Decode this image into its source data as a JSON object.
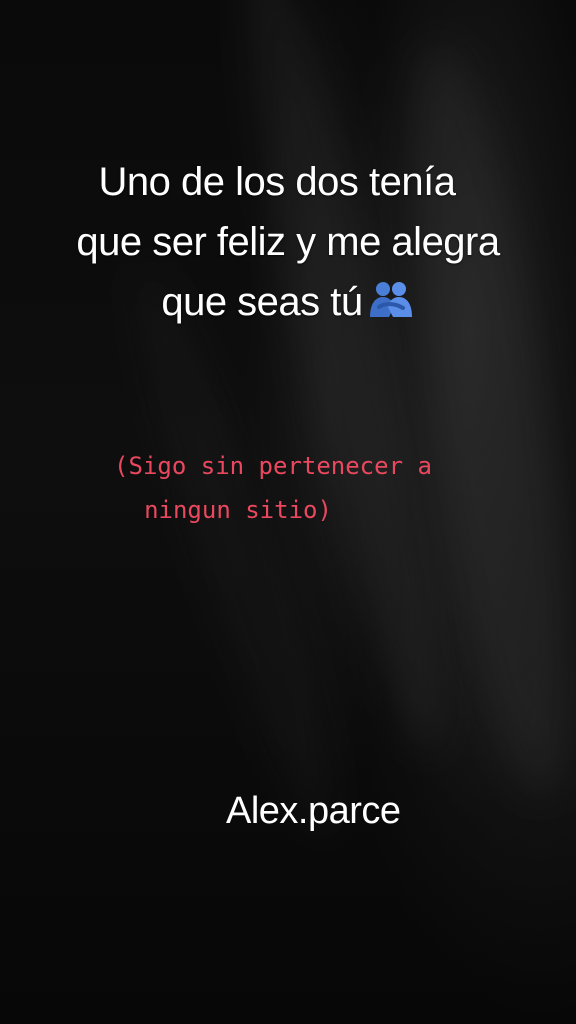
{
  "background": {
    "color": "#050505"
  },
  "headline": {
    "line1": "Uno de los dos tenía",
    "line2": "que ser feliz y me alegra",
    "line3": "que seas tú",
    "emoji_icon": "people-hugging-icon",
    "color": "#ffffff"
  },
  "subtext": {
    "line1": "(Sigo sin pertenecer a",
    "line2": "ningun sitio)",
    "color": "#e9485f"
  },
  "watermark": {
    "text": "Alex.parce",
    "color": "#ffffff"
  }
}
